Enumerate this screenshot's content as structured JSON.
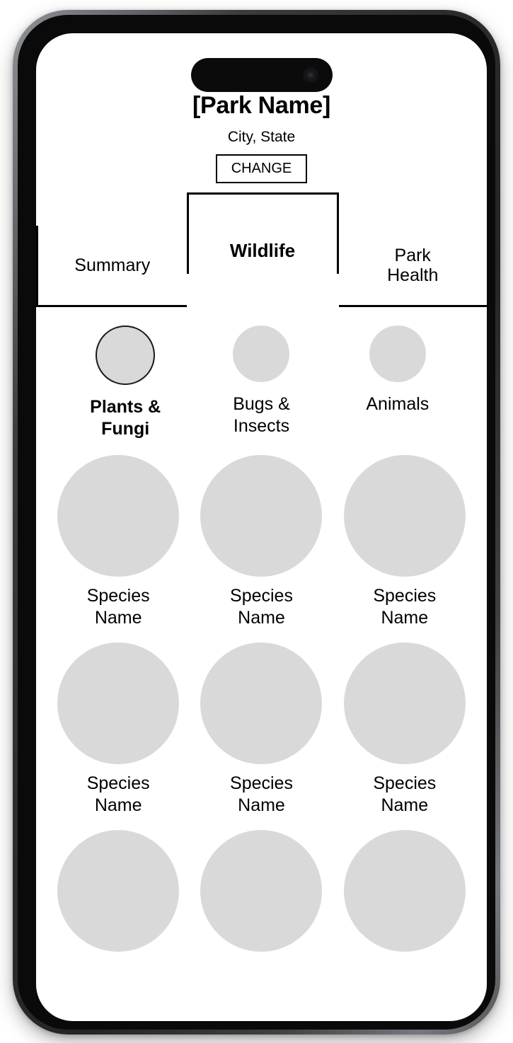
{
  "device": {
    "dynamic_island": "dynamic-island",
    "front_camera": "front-camera-icon",
    "buttons": {
      "mute": "mute-switch",
      "volume_up": "volume-up-button",
      "volume_down": "volume-down-button",
      "power": "power-button"
    }
  },
  "header": {
    "park_name": "[Park Name]",
    "location": "City, State",
    "change_label": "CHANGE"
  },
  "tabs": [
    {
      "label": "Summary",
      "active": false
    },
    {
      "label": "Wildlife",
      "active": true
    },
    {
      "label": "Park\nHealth",
      "active": false
    }
  ],
  "categories": [
    {
      "label": "Plants &\nFungi",
      "selected": true
    },
    {
      "label": "Bugs &\nInsects",
      "selected": false
    },
    {
      "label": "Animals",
      "selected": false
    }
  ],
  "species": [
    {
      "name": "Species\nName"
    },
    {
      "name": "Species\nName"
    },
    {
      "name": "Species\nName"
    },
    {
      "name": "Species\nName"
    },
    {
      "name": "Species\nName"
    },
    {
      "name": "Species\nName"
    },
    {
      "name": ""
    },
    {
      "name": ""
    },
    {
      "name": ""
    }
  ],
  "colors": {
    "placeholder_fill": "#d9d9d9",
    "outline": "#000000",
    "screen_background": "#ffffff",
    "selected_ring": "#1a1a1a"
  }
}
